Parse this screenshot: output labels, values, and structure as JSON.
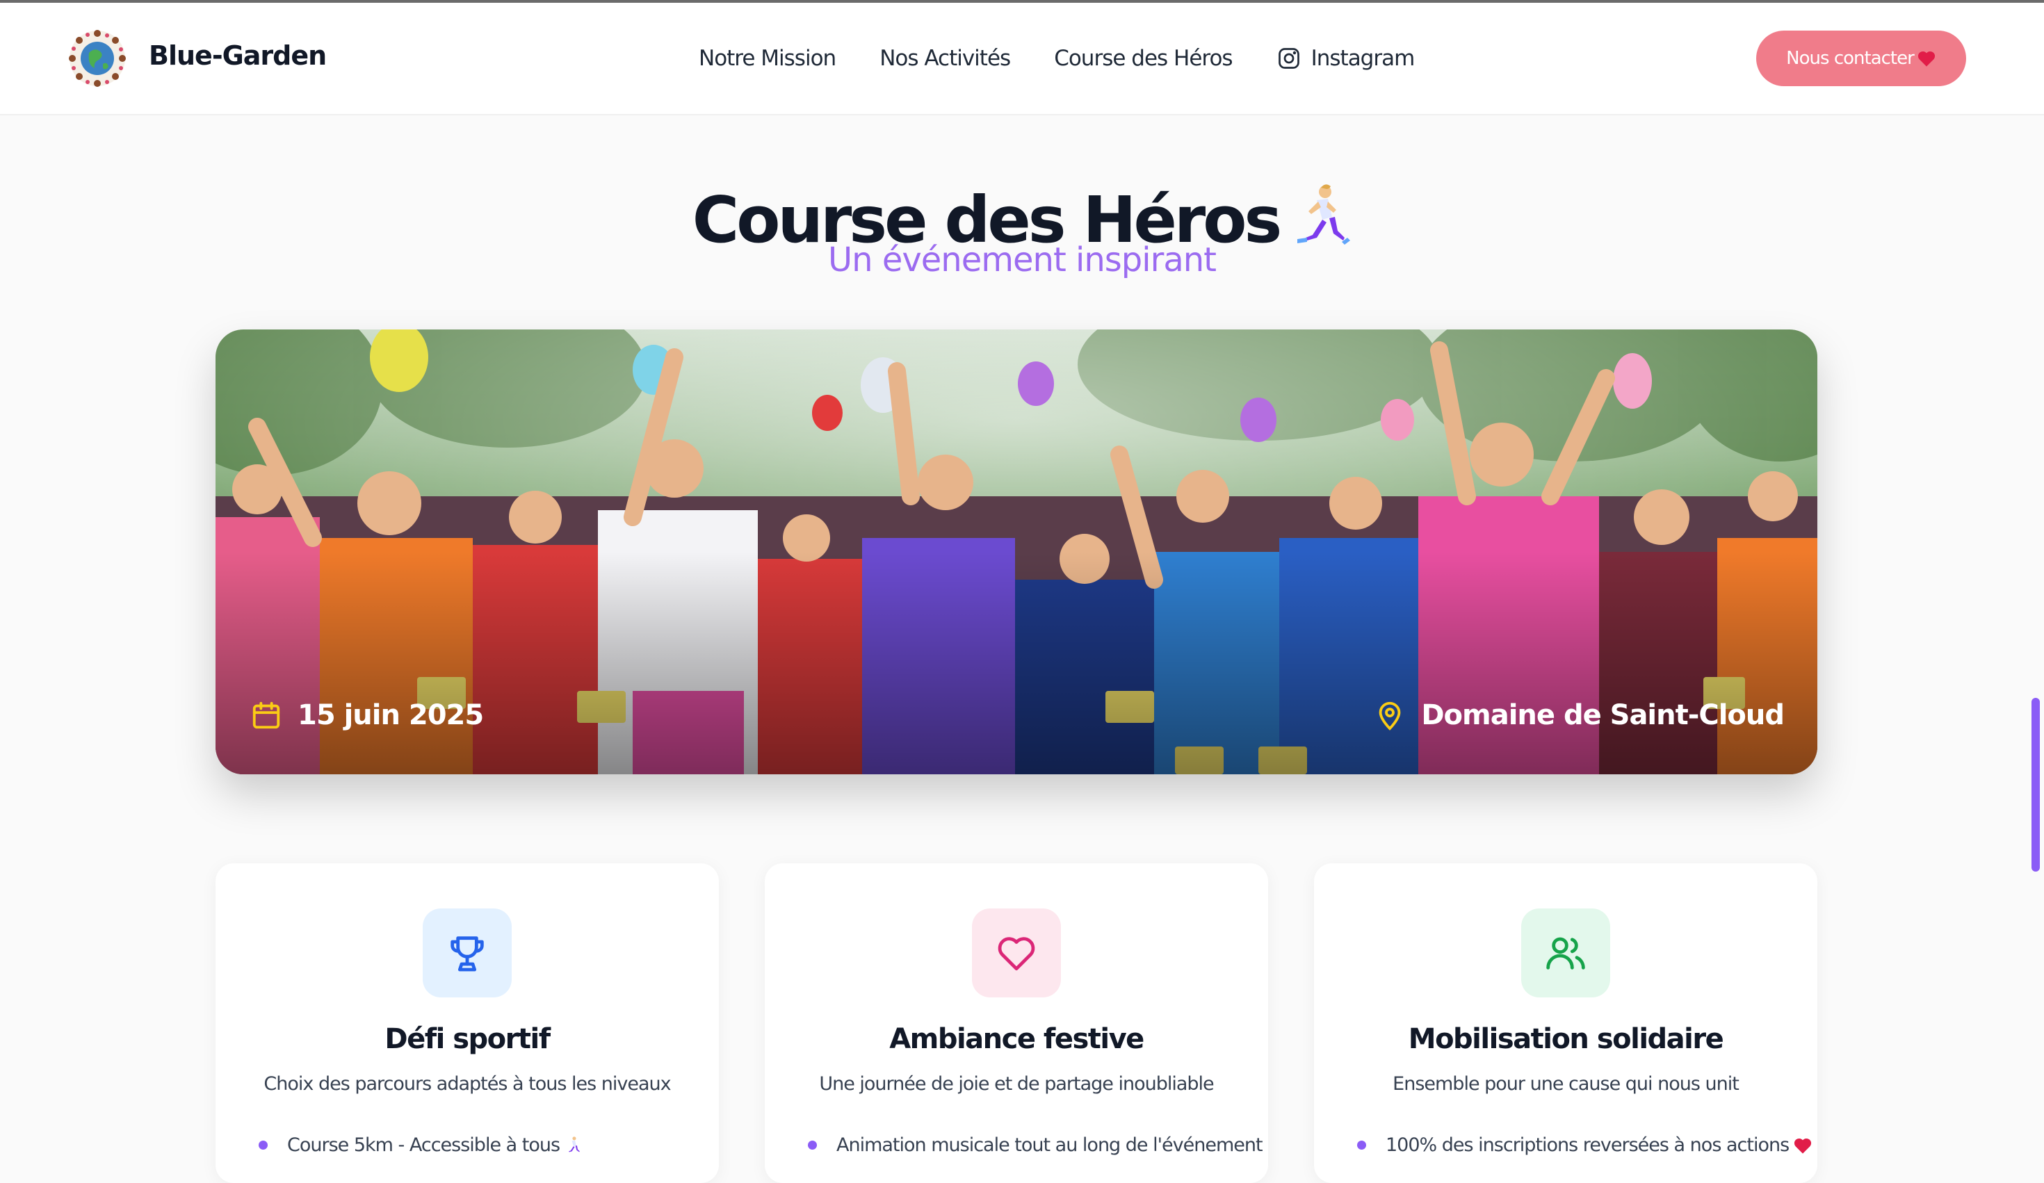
{
  "nav": {
    "brand": "Blue-Garden",
    "links": [
      "Notre Mission",
      "Nos Activités",
      "Course des Héros",
      "Instagram"
    ],
    "contact_label": "Nous contacter"
  },
  "hero": {
    "title": "Course des Héros",
    "subtitle": "Un événement inspirant",
    "date": "15 juin 2025",
    "location": "Domaine de Saint-Cloud"
  },
  "features": [
    {
      "title": "Défi sportif",
      "description": "Choix des parcours adaptés à tous les niveaux",
      "bullet": "Course 5km - Accessible à tous",
      "icon": "trophy-icon",
      "color": "#2563eb",
      "bg": "#e3f1ff"
    },
    {
      "title": "Ambiance festive",
      "description": "Une journée de joie et de partage inoubliable",
      "bullet": "Animation musicale tout au long de l'événement",
      "icon": "heart-icon",
      "color": "#db2777",
      "bg": "#fde7ee"
    },
    {
      "title": "Mobilisation solidaire",
      "description": "Ensemble pour une cause qui nous unit",
      "bullet": "100% des inscriptions reversées à nos actions",
      "icon": "users-icon",
      "color": "#16a34a",
      "bg": "#e3f8ec"
    }
  ],
  "colors": {
    "accent": "#8b5cf6",
    "contact_button": "#f07c8a",
    "hero_icons": "#facc15"
  }
}
